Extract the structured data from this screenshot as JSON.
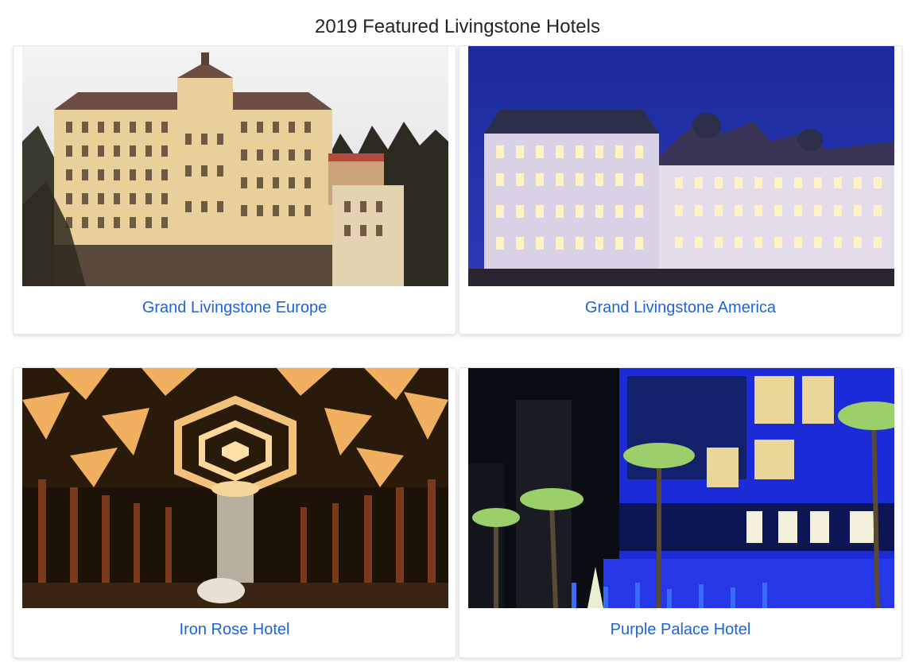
{
  "page": {
    "title": "2019 Featured Livingstone Hotels"
  },
  "hotels": [
    {
      "name": "Grand Livingstone Europe",
      "photo": "grand-hotel-facade-photo"
    },
    {
      "name": "Grand Livingstone America",
      "photo": "night-palace-hotel-photo"
    },
    {
      "name": "Iron Rose Hotel",
      "photo": "golden-lobby-ceiling-photo"
    },
    {
      "name": "Purple Palace Hotel",
      "photo": "blue-lit-hotel-palms-photo"
    }
  ],
  "colors": {
    "link": "#1e64d8",
    "title": "#212529"
  }
}
